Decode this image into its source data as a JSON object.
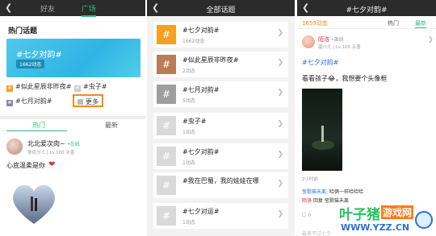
{
  "panel1": {
    "tabs": [
      "好友",
      "广场"
    ],
    "section_title": "热门话题",
    "banner": {
      "title": "#七夕对韵#",
      "count": "1662动态"
    },
    "tags": [
      "#似此星辰非昨夜#",
      "#虫子#",
      "#七月对韵#"
    ],
    "more_label": "更多",
    "subtabs": [
      "热门",
      "最新"
    ],
    "post": {
      "user": "北北爱次肉~",
      "online": "•在线",
      "meta": "常玖分 C | Lv.100 天香",
      "text": "心底温柔是你"
    }
  },
  "panel2": {
    "title": "全部话题",
    "topics": [
      {
        "name": "#七夕对韵#",
        "count": "1662动态"
      },
      {
        "name": "#似此星辰非昨夜#",
        "count": "2动态"
      },
      {
        "name": "#七月对韵#",
        "count": "5动态"
      },
      {
        "name": "#虫子#",
        "count": "1动态"
      },
      {
        "name": "#七夕对韵#",
        "count": "1动态"
      },
      {
        "name": "#我在巴蜀，我的娃娃在哪",
        "count": ""
      },
      {
        "name": "#七夕对运#",
        "count": "1动态"
      }
    ]
  },
  "panel3": {
    "title": "#七夕对韵#",
    "count": "1659动态",
    "tabs": [
      "热门",
      "最新"
    ],
    "post": {
      "user": "陌洛",
      "online": "•离线",
      "meta": "毫小九 | Lv.100 五香",
      "tag": "#七夕对韵#",
      "text": "看看孩子😂，我想要个头像框",
      "time": "2小时前"
    },
    "comments": [
      {
        "name": "莹歌猫未离",
        "text": "哈俩一样哈哈哈"
      },
      {
        "name": "陌洛",
        "text": "回复 莹歌猫未离"
      }
    ],
    "footer": {
      "count": "0",
      "next": "最美不过七夕"
    }
  },
  "watermark": {
    "name": "叶子猪",
    "sub": "游戏网",
    "url": "WWW.YZZ.CN"
  }
}
